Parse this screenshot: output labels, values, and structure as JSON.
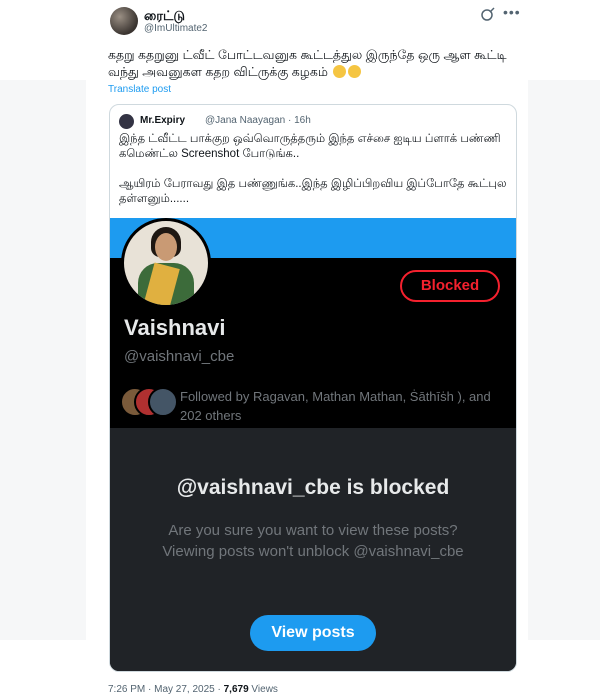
{
  "tweet": {
    "author_name": "ரைட்டு",
    "author_handle": "@ImUltimate2",
    "text": "கதறு கதறுனு ட்வீட் போட்டவனுக கூட்டத்துல இருந்தே ஒரு ஆள கூட்டி வந்து அவனுகள கதற விட்ருக்கு கழகம்",
    "translate_label": "Translate post",
    "timestamp": "7:26 PM · May 27, 2025 · ",
    "views_count": "7,679",
    "views_label": " Views"
  },
  "quote": {
    "author_name": "Mr.Expiry",
    "author_handle": "@Jana Naayagan · 16h",
    "text": "இந்த ட்வீட்ட பாக்குற ஒவ்வொருத்தரும் இந்த எச்சை ஐடிய ப்ளாக் பண்ணி கமெண்ட்ல Screenshot போடுங்க..\n\nஆயிரம் பேராவது இத பண்ணுங்க..இந்த இழிப்பிறவிய இப்போதே கூட்புல தள்ளனும்......"
  },
  "screenshot": {
    "blocked_label": "Blocked",
    "profile_name": "Vaishnavi",
    "profile_handle": "@vaishnavi_cbe",
    "followed_by": "Followed by Ragavan, Mathan Mathan, Ṡāthīṡh ), and 202 others",
    "blocked_title": "@vaishnavi_cbe is blocked",
    "blocked_body": "Are you sure you want to view these posts? Viewing posts won't unblock @vaishnavi_cbe",
    "view_button": "View posts"
  },
  "icons": {
    "grok": "grok-icon",
    "more": "more-icon",
    "emoji": "grinning-cat-emoji"
  },
  "colors": {
    "accent": "#1d9bf0",
    "blocked": "#f4212e",
    "dark_bg": "#000000",
    "panel_bg": "#202327"
  }
}
